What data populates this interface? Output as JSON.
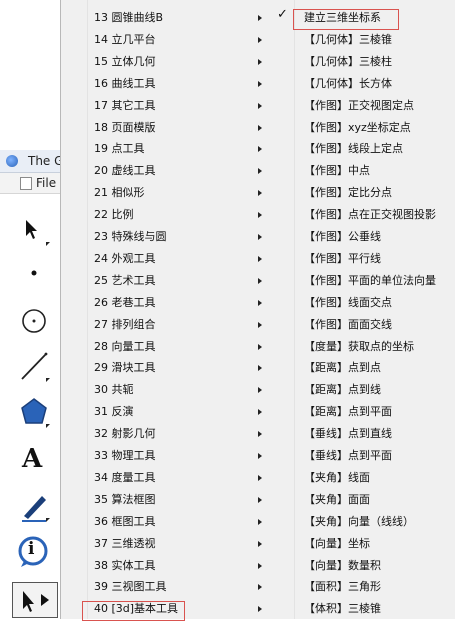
{
  "background_window": {
    "title": "The G",
    "menu_label": "File"
  },
  "tool_menu": {
    "items": [
      "13 圆锥曲线B",
      "14 立几平台",
      "15 立体几何",
      "16 曲线工具",
      "17 其它工具",
      "18 页面模版",
      "19 点工具",
      "20 虚线工具",
      "21 相似形",
      "22 比例",
      "23 特殊线与圆",
      "24 外观工具",
      "25 艺术工具",
      "26 老巷工具",
      "27 排列组合",
      "28 向量工具",
      "29 滑块工具",
      "30 共轭",
      "31 反演",
      "32 射影几何",
      "33 物理工具",
      "34 度量工具",
      "35 算法框图",
      "36 框图工具",
      "37 三维透视",
      "38 实体工具",
      "39 三视图工具",
      "40 [3d]基本工具"
    ]
  },
  "submenu": {
    "items": [
      "建立三维坐标系",
      "【几何体】三棱锥",
      "【几何体】三棱柱",
      "【几何体】长方体",
      "【作图】正交视图定点",
      "【作图】xyz坐标定点",
      "【作图】线段上定点",
      "【作图】中点",
      "【作图】定比分点",
      "【作图】点在正交视图投影",
      "【作图】公垂线",
      "【作图】平行线",
      "【作图】平面的单位法向量",
      "【作图】线面交点",
      "【作图】面面交线",
      "【度量】获取点的坐标",
      "【距离】点到点",
      "【距离】点到线",
      "【距离】点到平面",
      "【垂线】点到直线",
      "【垂线】点到平面",
      "【夹角】线面",
      "【夹角】面面",
      "【夹角】向量（线线）",
      "【向量】坐标",
      "【向量】数量积",
      "【面积】三角形",
      "【体积】三棱锥"
    ],
    "checked_index": 0,
    "check_mark": "✓"
  },
  "toolbar": {
    "text_tool_glyph": "A",
    "info_tool_glyph": "i"
  },
  "colors": {
    "highlight_border": "#d9534f",
    "menu_bg": "#f0f0f0",
    "accent_blue": "#2a63b8"
  }
}
